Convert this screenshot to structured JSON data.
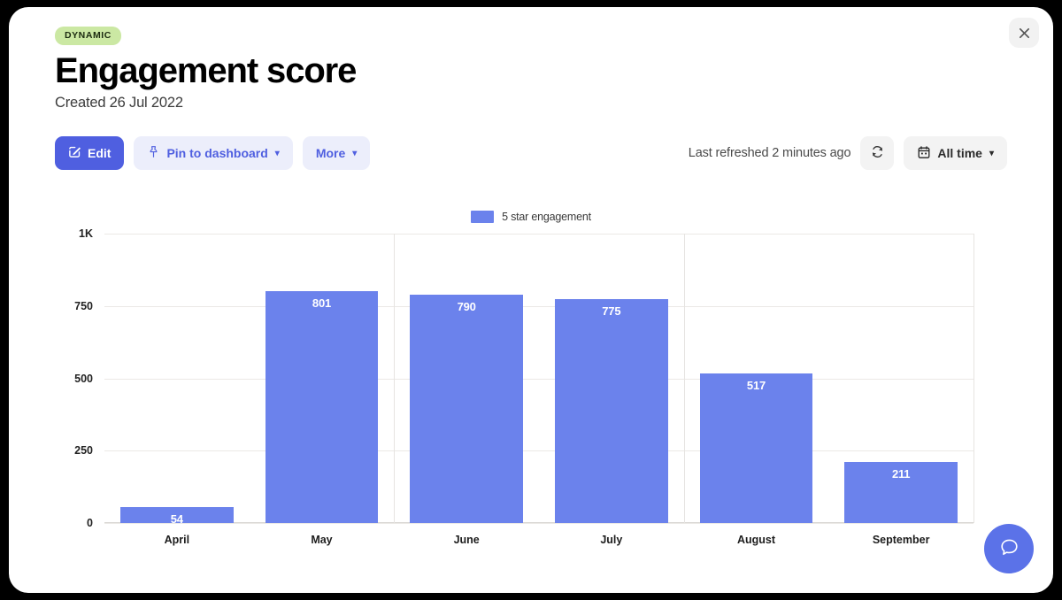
{
  "window": {
    "close_icon": "close-icon"
  },
  "header": {
    "badge": "DYNAMIC",
    "title": "Engagement score",
    "subtitle": "Created 26 Jul 2022"
  },
  "toolbar": {
    "edit_label": "Edit",
    "edit_icon": "edit-pencil-square-icon",
    "pin_label": "Pin to dashboard",
    "pin_icon": "pushpin-icon",
    "more_label": "More",
    "caret_icon": "chevron-down-icon",
    "refreshed_label": "Last refreshed 2 minutes ago",
    "refresh_icon": "refresh-icon",
    "date_range_label": "All time",
    "calendar_icon": "calendar-icon"
  },
  "chat": {
    "icon": "chat-bubble-icon"
  },
  "colors": {
    "accent_blue": "#4f5fe0",
    "bar_blue": "#6b82ec",
    "badge_green": "#cbe8a3",
    "soft_button_bg": "#eceefb",
    "plain_button_bg": "#f3f3f3"
  },
  "chart_data": {
    "type": "bar",
    "title": "",
    "xlabel": "",
    "ylabel": "",
    "categories": [
      "April",
      "May",
      "June",
      "July",
      "August",
      "September"
    ],
    "series": [
      {
        "name": "5 star engagement",
        "color": "#6b82ec",
        "values": [
          54,
          801,
          790,
          775,
          517,
          211
        ]
      }
    ],
    "value_labels": [
      "54",
      "801",
      "790",
      "775",
      "517",
      "211"
    ],
    "ylim": [
      0,
      1000
    ],
    "yticks": [
      0,
      250,
      500,
      750,
      1000
    ],
    "ytick_labels": [
      "0",
      "250",
      "500",
      "750",
      "1K"
    ],
    "grid": true,
    "legend_position": "top-center",
    "legend": [
      "5 star engagement"
    ]
  }
}
